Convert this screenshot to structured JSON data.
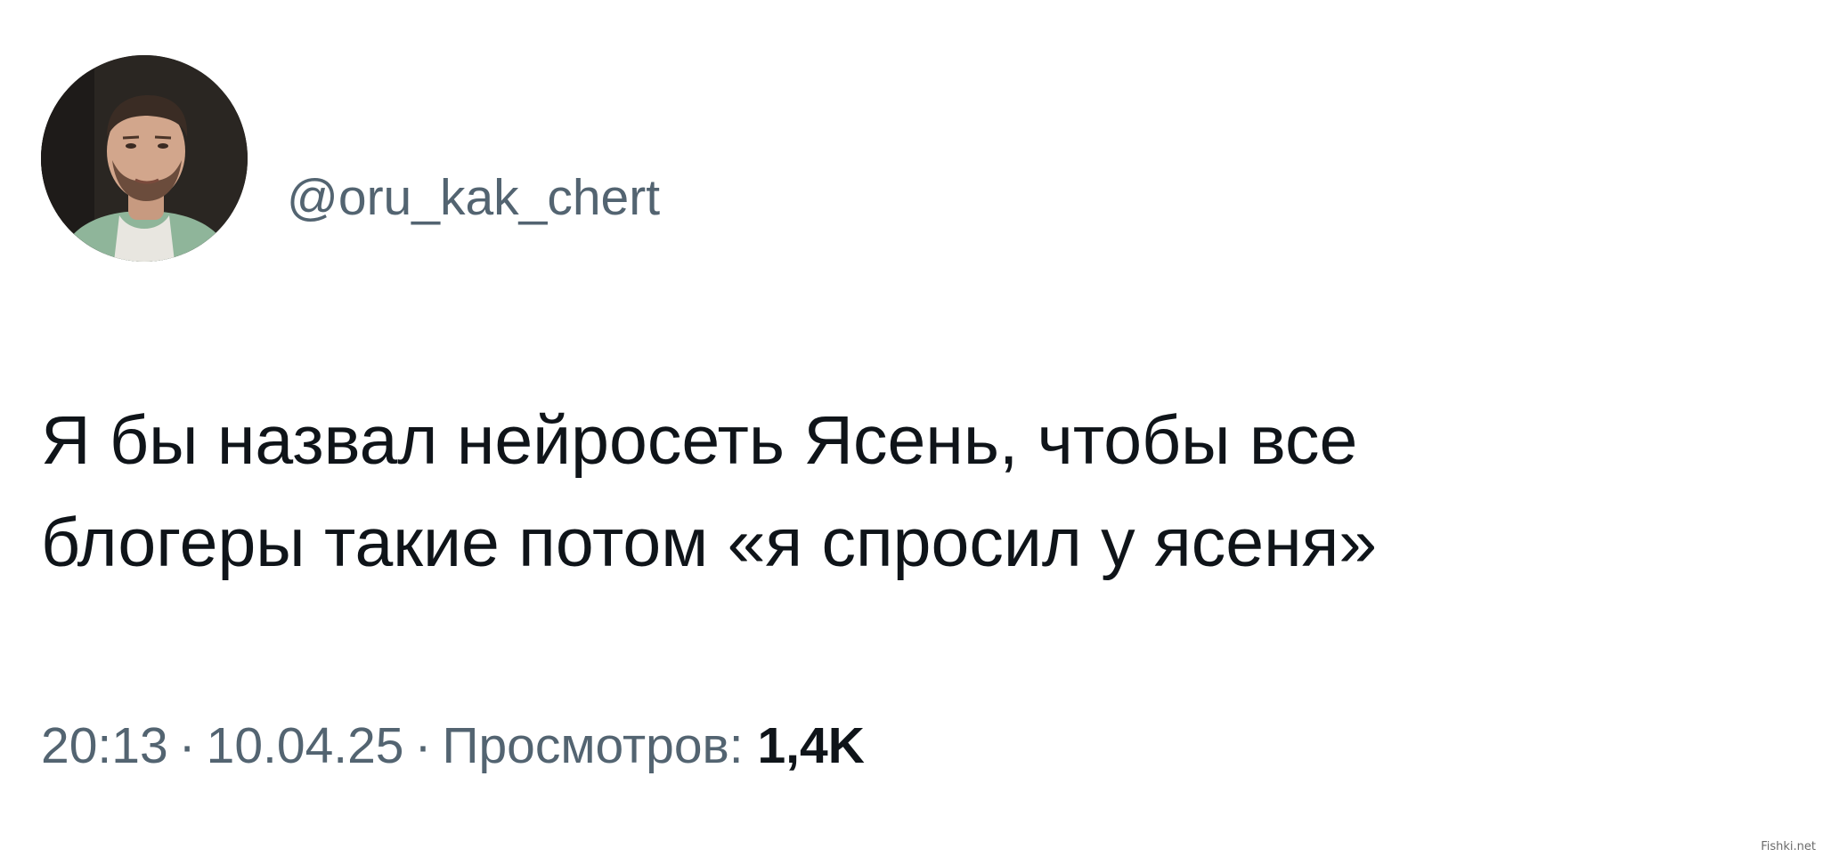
{
  "tweet": {
    "handle": "@oru_kak_chert",
    "text_lines": [
      "Я бы назвал нейросеть Ясень, чтобы все",
      "блогеры такие потом «я спросил у ясеня»"
    ],
    "time": "20:13",
    "separator": "·",
    "date": "10.04.25",
    "views_label": "Просмотров:",
    "views_count": "1,4K"
  },
  "watermark": "Fishki.net"
}
